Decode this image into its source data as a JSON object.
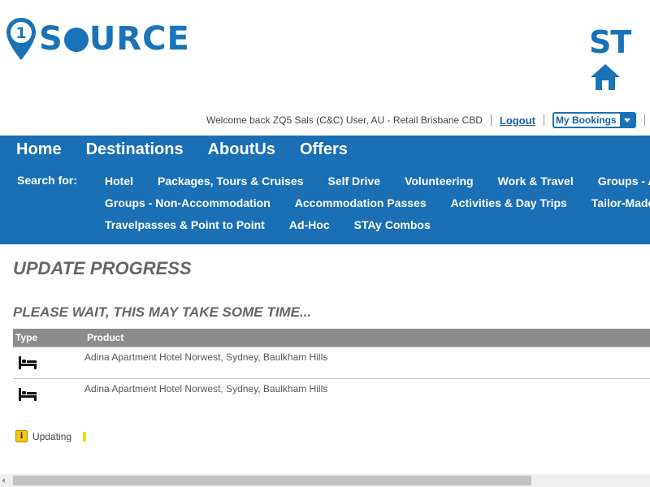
{
  "header": {
    "logo_number": "1",
    "logo_text_before": "S",
    "logo_text_after": "URCE",
    "partner_logo": "ST",
    "colors": {
      "brand_blue": "#1a73b8",
      "nav_blue": "#1a6fb5",
      "table_header_gray": "#8c8c8c",
      "status_yellow": "#f5c518"
    }
  },
  "userbar": {
    "welcome": "Welcome back ZQ5 Sals (C&C) User, AU - Retail Brisbane CBD",
    "logout": "Logout",
    "my_bookings": "My Bookings"
  },
  "nav": {
    "main": [
      "Home",
      "Destinations",
      "AboutUs",
      "Offers"
    ],
    "search_label": "Search for:",
    "sub_rows": [
      [
        "Hotel",
        "Packages, Tours & Cruises",
        "Self Drive",
        "Volunteering",
        "Work & Travel",
        "Groups - Acco"
      ],
      [
        "Groups - Non-Accommodation",
        "Accommodation Passes",
        "Activities & Day Trips",
        "Tailor-Made"
      ],
      [
        "Travelpasses & Point to Point",
        "Ad-Hoc",
        "STAy Combos"
      ]
    ]
  },
  "page": {
    "title": "UPDATE PROGRESS",
    "subtitle": "PLEASE WAIT, THIS MAY TAKE SOME TIME...",
    "table": {
      "columns": [
        "Type",
        "Product"
      ],
      "rows": [
        {
          "icon": "bed-icon",
          "product": "Adina Apartment Hotel Norwest, Sydney, Baulkham Hills"
        },
        {
          "icon": "bed-icon",
          "product": "Adina Apartment Hotel Norwest, Sydney, Baulkham Hills"
        }
      ]
    },
    "status": {
      "icon": "info-icon",
      "glyph": "i",
      "text": "Updating"
    }
  }
}
